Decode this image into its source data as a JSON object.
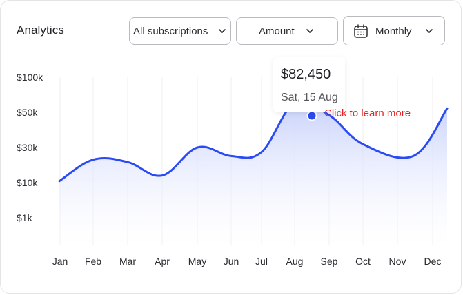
{
  "header": {
    "title": "Analytics",
    "subscriptions_filter": "All subscriptions",
    "metric_filter": "Amount",
    "period_filter": "Monthly"
  },
  "icons": {
    "chevron": "chevron-down-icon",
    "calendar": "calendar-icon"
  },
  "tooltip": {
    "value": "$82,450",
    "date": "Sat, 15 Aug",
    "hint": "Click to learn more"
  },
  "colors": {
    "line": "#2b4bf2",
    "fill_top": "#c5cffb",
    "hint": "#e52424"
  },
  "chart_data": {
    "type": "area",
    "title": "",
    "xlabel": "",
    "ylabel": "",
    "y_scale": "log",
    "y_ticks": [
      "$100k",
      "$50k",
      "$30k",
      "$10k",
      "$1k"
    ],
    "categories": [
      "Jan",
      "Feb",
      "Mar",
      "Apr",
      "May",
      "Jun",
      "Jul",
      "Aug",
      "Sep",
      "Oct",
      "Nov",
      "Dec"
    ],
    "series": [
      {
        "values": [
          10500,
          20500,
          19000,
          12500,
          30000,
          23000,
          26000,
          60000,
          48000,
          31500,
          23000,
          54000
        ]
      }
    ],
    "highlight": {
      "category": "Aug",
      "value": 82450
    },
    "grid": "vertical"
  }
}
